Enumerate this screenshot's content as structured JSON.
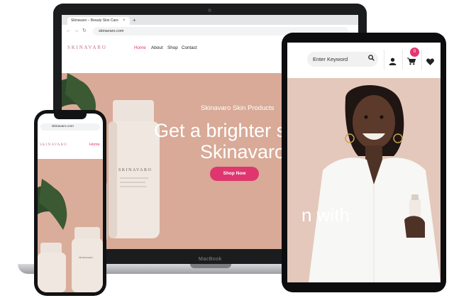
{
  "laptop": {
    "brand": "MacBook",
    "browser": {
      "tab_title": "Skinavaro – Beauty Skin Care",
      "tab_close": "×",
      "new_tab": "+",
      "back": "←",
      "forward": "→",
      "reload": "↻",
      "url": "skinavaro.com"
    },
    "site": {
      "logo": "SKINAVARO",
      "menu": [
        "Home",
        "About",
        "Shop",
        "Contact"
      ],
      "hero_subtitle": "Skinavaro Skin Products",
      "hero_line1": "Get a brighter skin",
      "hero_line2": "Skinavaro.",
      "cta": "Shop Now",
      "product_label": "SKINAVARO"
    }
  },
  "tablet": {
    "search_placeholder": "Enter Keyword",
    "cart_count": "0",
    "hero_text": "n with",
    "icons": [
      "search-icon",
      "user-icon",
      "cart-icon",
      "heart-icon"
    ]
  },
  "phone": {
    "url": "skinavaro.com",
    "logo": "SKINAVARO",
    "menu_active": "Home",
    "product_label": "SKINAVARO"
  },
  "colors": {
    "accent": "#e0376f",
    "hero_bg": "#d8aa97",
    "logo": "#c2738a"
  }
}
